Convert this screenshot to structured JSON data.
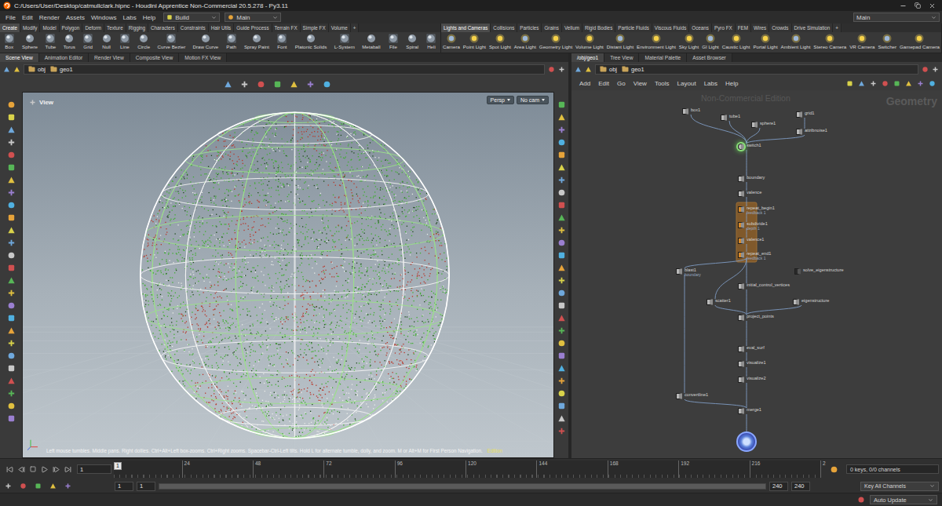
{
  "window": {
    "title": "C:/Users/User/Desktop/catmullclark.hipnc - Houdini Apprentice Non-Commercial 20.5.278 - Py3.11"
  },
  "menu": [
    "File",
    "Edit",
    "Render",
    "Assets",
    "Windows",
    "Labs",
    "Help"
  ],
  "desktop": "Build",
  "context": "Main",
  "right_context": "Main",
  "shelf_tabs_left": [
    {
      "label": "Create",
      "selected": true
    },
    {
      "label": "Modify",
      "selected": false
    },
    {
      "label": "Model",
      "selected": false
    },
    {
      "label": "Polygon",
      "selected": false
    },
    {
      "label": "Deform",
      "selected": false
    },
    {
      "label": "Texture",
      "selected": false
    },
    {
      "label": "Rigging",
      "selected": false
    },
    {
      "label": "Characters",
      "selected": false
    },
    {
      "label": "Constraints",
      "selected": false
    },
    {
      "label": "Hair Utils",
      "selected": false
    },
    {
      "label": "Guide Process",
      "selected": false
    },
    {
      "label": "Terrain FX",
      "selected": false
    },
    {
      "label": "Simple FX",
      "selected": false
    },
    {
      "label": "Volume",
      "selected": false
    },
    {
      "label": "+",
      "selected": false
    }
  ],
  "shelf_tabs_right": [
    {
      "label": "Lights and Cameras",
      "selected": true
    },
    {
      "label": "Collisions",
      "selected": false
    },
    {
      "label": "Particles",
      "selected": false
    },
    {
      "label": "Grains",
      "selected": false
    },
    {
      "label": "Vellum",
      "selected": false
    },
    {
      "label": "Rigid Bodies",
      "selected": false
    },
    {
      "label": "Particle Fluids",
      "selected": false
    },
    {
      "label": "Viscous Fluids",
      "selected": false
    },
    {
      "label": "Oceans",
      "selected": false
    },
    {
      "label": "Pyro FX",
      "selected": false
    },
    {
      "label": "FEM",
      "selected": false
    },
    {
      "label": "Wires",
      "selected": false
    },
    {
      "label": "Crowds",
      "selected": false
    },
    {
      "label": "Drive Simulation",
      "selected": false
    },
    {
      "label": "+",
      "selected": false
    }
  ],
  "tools_left": [
    "Box",
    "Sphere",
    "Tube",
    "Torus",
    "Grid",
    "Null",
    "Line",
    "Circle",
    "Curve Bezier",
    "Draw Curve",
    "Path",
    "Spray Paint",
    "Font",
    "Platonic Solids",
    "L-System",
    "Metaball",
    "File",
    "Spiral",
    "Heli"
  ],
  "tools_right": [
    "Camera",
    "Point Light",
    "Spot Light",
    "Area Light",
    "Geometry Light",
    "Volume Light",
    "Distant Light",
    "Environment Light",
    "Sky Light",
    "GI Light",
    "Caustic Light",
    "Portal Light",
    "Ambient Light",
    "Stereo Camera",
    "VR Camera",
    "Switcher",
    "Gamepad Camera"
  ],
  "pane_tabs_left": [
    {
      "label": "Scene View",
      "selected": true
    },
    {
      "label": "Animation Editor",
      "selected": false
    },
    {
      "label": "Render View",
      "selected": false
    },
    {
      "label": "Composite View",
      "selected": false
    },
    {
      "label": "Motion FX View",
      "selected": false
    }
  ],
  "pane_tabs_right": [
    {
      "label": "/obj/geo1",
      "selected": true
    },
    {
      "label": "Tree View",
      "selected": false
    },
    {
      "label": "Material Palette",
      "selected": false
    },
    {
      "label": "Asset Browser",
      "selected": false
    }
  ],
  "path_left": [
    "obj",
    "geo1"
  ],
  "path_right": [
    "obj",
    "geo1"
  ],
  "viewport": {
    "title": "View",
    "projection": "Persp",
    "camera": "No cam",
    "hint": "Left mouse tumbles. Middle pans. Right dollies. Ctrl+Alt+Left box-zooms. Ctrl+Right zooms. Spacebar-Ctrl-Left tilts. Hold L for alternate tumble, dolly, and zoom. M or Alt+M for First Person Navigation.",
    "watermark": "Edition"
  },
  "network": {
    "menu": [
      "Add",
      "Edit",
      "Go",
      "View",
      "Tools",
      "Layout",
      "Labs",
      "Help"
    ],
    "watermark": "Non-Commercial Edition",
    "context": "Geometry",
    "nodes": [
      {
        "name": "box1",
        "kind": "sop",
        "selected": false,
        "display": false,
        "inputs": []
      },
      {
        "name": "tube1",
        "kind": "sop",
        "selected": false,
        "display": false,
        "inputs": []
      },
      {
        "name": "sphere1",
        "kind": "sop",
        "selected": false,
        "display": false,
        "inputs": []
      },
      {
        "name": "grid1",
        "kind": "sop",
        "selected": false,
        "display": false,
        "inputs": []
      },
      {
        "name": "attribnoise1",
        "kind": "sop",
        "selected": false,
        "display": false,
        "inputs": [
          "grid1"
        ]
      },
      {
        "name": "switch1",
        "kind": "sop",
        "selected": true,
        "display": false,
        "inputs": [
          "box1",
          "tube1",
          "sphere1",
          "attribnoise1"
        ]
      },
      {
        "name": "boundary",
        "kind": "sop",
        "selected": false,
        "display": false,
        "inputs": [
          "switch1"
        ]
      },
      {
        "name": "valence",
        "kind": "sop",
        "selected": false,
        "display": false,
        "inputs": [
          "boundary"
        ]
      },
      {
        "name": "repeat_begin1",
        "sub": "feedback 1",
        "kind": "loop",
        "selected": false,
        "display": false,
        "inputs": [
          "valence"
        ]
      },
      {
        "name": "subdivide1",
        "sub": "depth 1",
        "kind": "loop",
        "selected": false,
        "display": false,
        "inputs": [
          "repeat_begin1"
        ]
      },
      {
        "name": "valence1",
        "kind": "loop",
        "selected": false,
        "display": false,
        "inputs": [
          "subdivide1"
        ]
      },
      {
        "name": "repeat_end1",
        "sub": "feedback 1",
        "kind": "loop",
        "selected": false,
        "display": false,
        "inputs": [
          "valence1"
        ]
      },
      {
        "name": "blast1",
        "sub": "boundary",
        "kind": "sop",
        "selected": false,
        "display": false,
        "inputs": [
          "repeat_end1"
        ]
      },
      {
        "name": "solve_eigenstructure",
        "kind": "python",
        "selected": false,
        "display": false,
        "inputs": []
      },
      {
        "name": "initial_control_vertices",
        "kind": "sop",
        "selected": false,
        "display": false,
        "inputs": [
          "repeat_end1"
        ]
      },
      {
        "name": "scatter1",
        "kind": "sop",
        "selected": false,
        "display": false,
        "inputs": [
          "repeat_end1"
        ]
      },
      {
        "name": "eigenstructure",
        "kind": "sop",
        "selected": false,
        "display": false,
        "inputs": []
      },
      {
        "name": "project_points",
        "kind": "sop",
        "selected": false,
        "display": false,
        "inputs": [
          "initial_control_vertices",
          "scatter1",
          "eigenstructure"
        ]
      },
      {
        "name": "eval_surf",
        "kind": "sop",
        "selected": false,
        "display": false,
        "inputs": [
          "project_points"
        ]
      },
      {
        "name": "visualize1",
        "kind": "sop",
        "selected": false,
        "display": false,
        "inputs": [
          "eval_surf"
        ]
      },
      {
        "name": "visualize2",
        "kind": "sop",
        "selected": false,
        "display": false,
        "inputs": [
          "visualize1"
        ]
      },
      {
        "name": "convertline1",
        "kind": "sop",
        "selected": false,
        "display": false,
        "inputs": [
          "blast1"
        ]
      },
      {
        "name": "merge1",
        "kind": "sop",
        "selected": false,
        "display": false,
        "inputs": [
          "visualize2",
          "convertline1"
        ]
      },
      {
        "kind": "output",
        "selected": false,
        "display": true,
        "inputs": [
          "merge1"
        ]
      }
    ]
  },
  "timeline": {
    "frame_field": "1",
    "playhead": {
      "label": "1",
      "level": 0
    },
    "ticks": [
      {
        "label": "24",
        "value": 24
      },
      {
        "label": "48",
        "value": 48
      },
      {
        "label": "72",
        "value": 72
      },
      {
        "label": "96",
        "value": 96
      },
      {
        "label": "120",
        "value": 120
      },
      {
        "label": "144",
        "value": 144
      },
      {
        "label": "168",
        "value": 168
      },
      {
        "label": "192",
        "value": 192
      },
      {
        "label": "216",
        "value": 216
      },
      {
        "label": "2",
        "value": 240
      }
    ],
    "keys": "0 keys, 0/0 channels"
  },
  "range": {
    "start": "1",
    "current": "1",
    "end": "240",
    "global_end": "240",
    "level": 1
  },
  "key_mode": "Key All Channels",
  "status": {
    "update": "Auto Update"
  }
}
